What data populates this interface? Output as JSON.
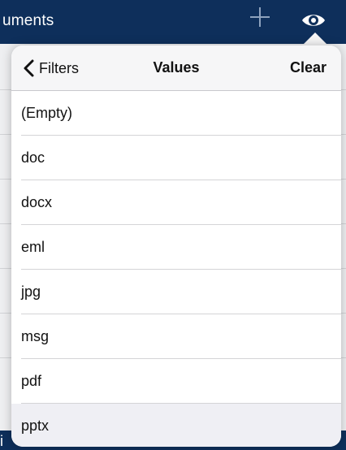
{
  "header": {
    "title_fragment": "uments"
  },
  "bottom_bar": {
    "label_fragment": "i"
  },
  "popover": {
    "back_label": "Filters",
    "title": "Values",
    "clear_label": "Clear",
    "values": [
      {
        "label": "(Empty)"
      },
      {
        "label": "doc"
      },
      {
        "label": "docx"
      },
      {
        "label": "eml"
      },
      {
        "label": "jpg"
      },
      {
        "label": "msg"
      },
      {
        "label": "pdf"
      },
      {
        "label": "pptx",
        "selected": true
      }
    ]
  },
  "icons": {
    "add": "plus-icon",
    "view": "eye-icon",
    "back": "chevron-left-icon",
    "row_info": "info-icon"
  },
  "colors": {
    "navbar": "#0e2f5b",
    "popover_header": "#f6f6f7",
    "selected_row": "#efeff4"
  }
}
